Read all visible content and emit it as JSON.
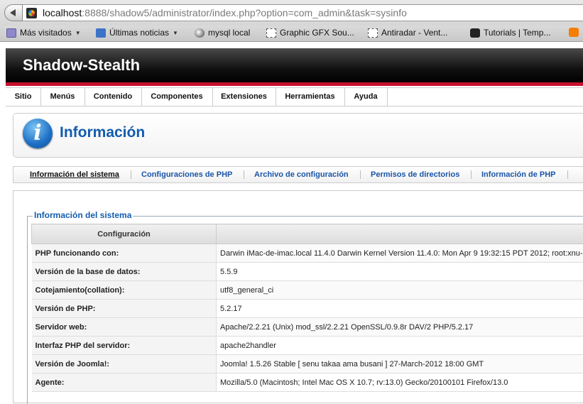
{
  "browser": {
    "url_host": "localhost",
    "url_rest": ":8888/shadow5/administrator/index.php?option=com_admin&task=sysinfo",
    "bookmarks": [
      {
        "label": "Más visitados",
        "icon": "folder-icon",
        "dropdown": true
      },
      {
        "label": "Últimas noticias",
        "icon": "rss-icon",
        "dropdown": true
      },
      {
        "label": "mysql local",
        "icon": "globe-icon",
        "dropdown": false
      },
      {
        "label": "Graphic GFX Sou...",
        "icon": "page-icon",
        "dropdown": false
      },
      {
        "label": "Antiradar - Vent...",
        "icon": "page-icon",
        "dropdown": false
      },
      {
        "label": "Tutorials | Temp...",
        "icon": "puzzle-icon",
        "dropdown": false
      }
    ]
  },
  "site": {
    "title": "Shadow-Stealth"
  },
  "menu": [
    "Sitio",
    "Menús",
    "Contenido",
    "Componentes",
    "Extensiones",
    "Herramientas",
    "Ayuda"
  ],
  "info": {
    "icon": "info-icon",
    "title": "Información"
  },
  "subtabs": [
    "Información del sistema",
    "Configuraciones de PHP",
    "Archivo de configuración",
    "Permisos de directorios",
    "Información de PHP"
  ],
  "section": {
    "legend": "Información del sistema",
    "header_config": "Configuración",
    "rows": [
      {
        "key": "PHP funcionando con:",
        "value": "Darwin iMac-de-imac.local 11.4.0 Darwin Kernel Version 11.4.0: Mon Apr 9 19:32:15 PDT 2012; root:xnu-"
      },
      {
        "key": "Versión de la base de datos:",
        "value": "5.5.9"
      },
      {
        "key": "Cotejamiento(collation):",
        "value": "utf8_general_ci"
      },
      {
        "key": "Versión de PHP:",
        "value": "5.2.17"
      },
      {
        "key": "Servidor web:",
        "value": "Apache/2.2.21 (Unix) mod_ssl/2.2.21 OpenSSL/0.9.8r DAV/2 PHP/5.2.17"
      },
      {
        "key": "Interfaz PHP del servidor:",
        "value": "apache2handler"
      },
      {
        "key": "Versión de Joomla!:",
        "value": "Joomla! 1.5.26 Stable [ senu takaa ama busani ] 27-March-2012 18:00 GMT"
      },
      {
        "key": "Agente:",
        "value": "Mozilla/5.0 (Macintosh; Intel Mac OS X 10.7; rv:13.0) Gecko/20100101 Firefox/13.0"
      }
    ]
  }
}
